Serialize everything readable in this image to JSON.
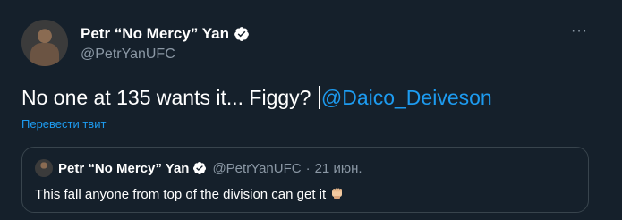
{
  "tweet": {
    "display_name": "Petr “No Mercy” Yan",
    "handle": "@PetrYanUFC",
    "text_main": "No one at 135 wants it... Figgy? ",
    "mention": "@Daico_Deiveson",
    "translate_link": "Перевести твит",
    "more_menu": "···"
  },
  "quote": {
    "display_name": "Petr “No Mercy” Yan",
    "handle": "@PetrYanUFC",
    "separator": "·",
    "date": "21 июн.",
    "text": "This fall anyone from top of the division can get it"
  },
  "icons": {
    "verified": "verified-badge-icon",
    "more": "more-options-icon",
    "emoji": "fist-bump-emoji-icon"
  },
  "colors": {
    "background": "#15202b",
    "accent": "#1d9bf0",
    "secondary_text": "#8b98a5",
    "border": "#38444d"
  }
}
